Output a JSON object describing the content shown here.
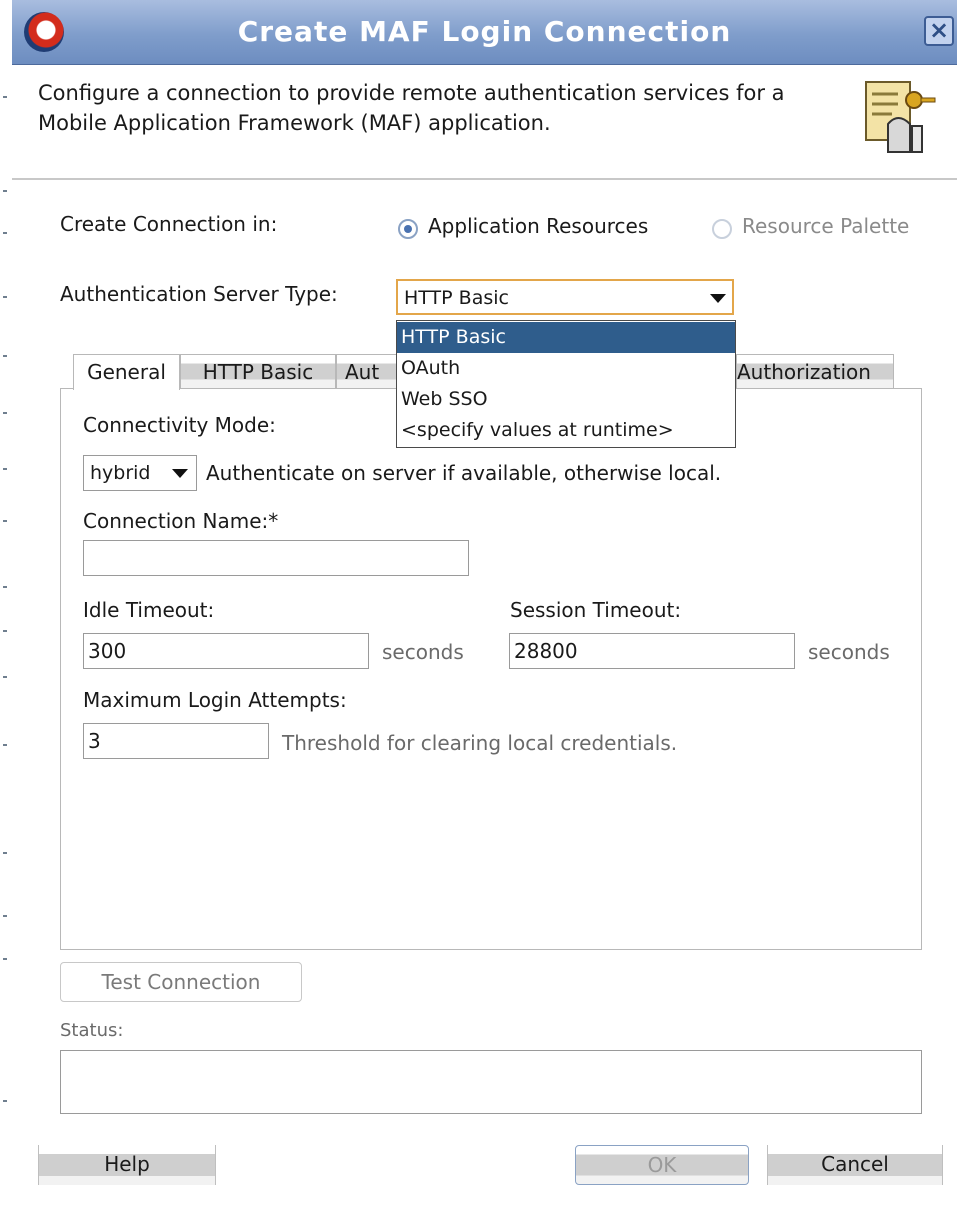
{
  "dialog": {
    "title": "Create MAF Login Connection",
    "description_line1": "Configure a connection to provide remote authentication services for a",
    "description_line2": "Mobile Application Framework (MAF) application."
  },
  "create_connection": {
    "label": "Create Connection in:",
    "options": [
      {
        "label": "Application Resources",
        "selected": true,
        "enabled": true
      },
      {
        "label": "Resource Palette",
        "selected": false,
        "enabled": false
      }
    ]
  },
  "auth_server_type": {
    "label": "Authentication Server Type:",
    "value": "HTTP Basic",
    "options": [
      "HTTP Basic",
      "OAuth",
      "Web SSO",
      "<specify values at runtime>"
    ]
  },
  "tabs": [
    {
      "label": "General",
      "active": true
    },
    {
      "label": "HTTP Basic",
      "active": false
    },
    {
      "label": "Aut",
      "active": false
    },
    {
      "label": "Authorization",
      "active": false
    }
  ],
  "general": {
    "connectivity_mode_label": "Connectivity Mode:",
    "connectivity_mode_value": "hybrid",
    "connectivity_mode_hint": "Authenticate on server if available, otherwise local.",
    "connection_name_label": "Connection Name:*",
    "connection_name_value": "",
    "idle_timeout_label": "Idle Timeout:",
    "idle_timeout_value": "300",
    "idle_timeout_unit": "seconds",
    "session_timeout_label": "Session Timeout:",
    "session_timeout_value": "28800",
    "session_timeout_unit": "seconds",
    "max_login_attempts_label": "Maximum Login Attempts:",
    "max_login_attempts_value": "3",
    "max_login_attempts_hint": "Threshold for clearing local credentials."
  },
  "test_connection_label": "Test Connection",
  "status_label": "Status:",
  "status_value": "",
  "buttons": {
    "help": "Help",
    "ok": "OK",
    "cancel": "Cancel"
  },
  "colors": {
    "titlebar": "#7f9dcb",
    "selected_item": "#2f5d8c",
    "focus_border": "#e3a64a"
  },
  "icons": {
    "app": "oracle-icon",
    "close": "close-icon",
    "description": "connection-key-icon",
    "dropdown": "triangle-down-icon"
  }
}
